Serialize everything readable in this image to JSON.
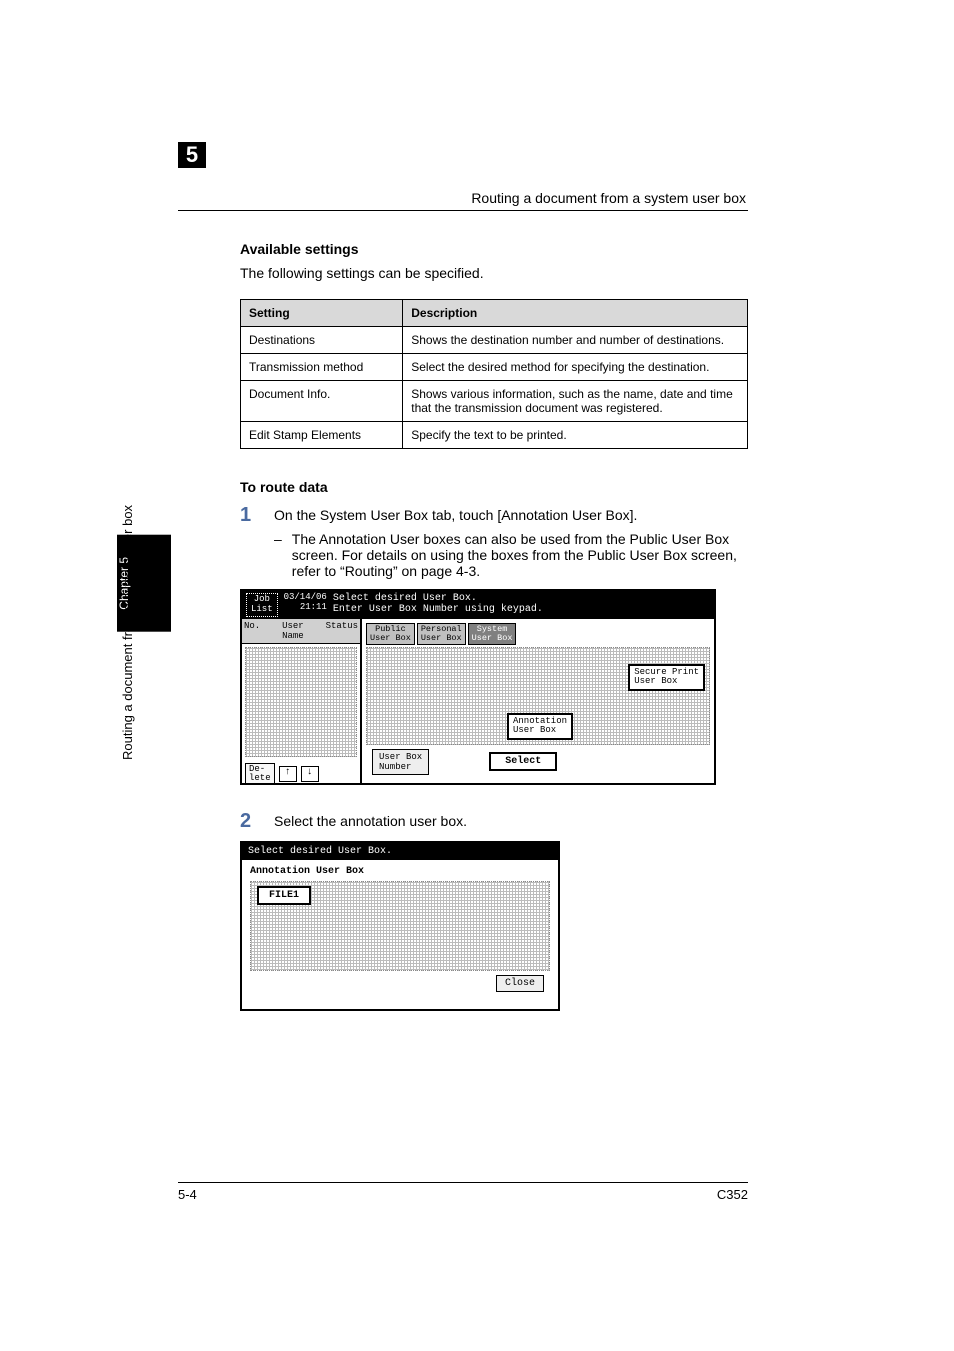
{
  "header": {
    "breadcrumb": "Routing a document from a system user box",
    "chapter_number": "5"
  },
  "content": {
    "heading1": "Available settings",
    "intro": "The following settings can be specified.",
    "table": {
      "headers": {
        "setting": "Setting",
        "description": "Description"
      },
      "rows": [
        {
          "setting": "Destinations",
          "description": "Shows the destination number and number of destinations."
        },
        {
          "setting": "Transmission method",
          "description": "Select the desired method for specifying the destination."
        },
        {
          "setting": "Document Info.",
          "description": "Shows various information, such as the name, date and time that the transmission document was registered."
        },
        {
          "setting": "Edit Stamp Elements",
          "description": "Specify the text to be printed."
        }
      ]
    },
    "heading2": "To route data",
    "steps": {
      "s1_num": "1",
      "s1_text": "On the System User Box tab, touch [Annotation User Box].",
      "s1_sub": "The Annotation User boxes can also be used from the Public User Box screen. For details on using the boxes from the Public User Box screen, refer to “Routing” on page 4-3.",
      "s1_dash": "–",
      "s2_num": "2",
      "s2_text": "Select the annotation user box."
    }
  },
  "screenshot1": {
    "top_tab": "Job\nList",
    "date": "03/14/06\n21:11",
    "title_line1": "Select desired User Box.",
    "title_line2": "Enter User Box Number using keypad.",
    "left_header_no": "No.",
    "left_header_user": "User\nName",
    "left_header_status": "Status",
    "left_delete": "De-\nlete",
    "arrow_up": "↑",
    "arrow_down": "↓",
    "tab_public": "Public\nUser Box",
    "tab_personal": "Personal\nUser Box",
    "tab_system": "System\nUser Box",
    "secure_print": "Secure Print\nUser Box",
    "annotation": "Annotation\nUser Box",
    "user_box_number": "User Box\nNumber",
    "select": "Select"
  },
  "screenshot2": {
    "top": "Select desired User Box.",
    "title": "Annotation User Box",
    "file": "FILE1",
    "close": "Close"
  },
  "side": {
    "text": "Routing a document from a system user box",
    "chapter": "Chapter 5"
  },
  "footer": {
    "left": "5-4",
    "right": "C352"
  }
}
